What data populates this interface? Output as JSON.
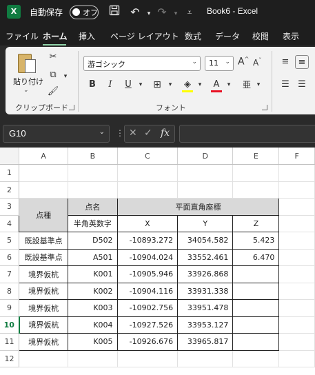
{
  "titlebar": {
    "app_icon": "X",
    "autosave_label": "自動保存",
    "autosave_state": "オフ",
    "doc_title": "Book6  -  Excel"
  },
  "menu": {
    "tabs": [
      "ファイル",
      "ホーム",
      "挿入",
      "ページ レイアウト",
      "数式",
      "データ",
      "校閲",
      "表示"
    ],
    "active": "ホーム"
  },
  "ribbon": {
    "clipboard": {
      "paste_label": "貼り付け",
      "group_label": "クリップボード"
    },
    "font": {
      "font_name": "游ゴシック",
      "font_size": "11",
      "grow_label": "A",
      "shrink_label": "A",
      "bold": "B",
      "italic": "I",
      "underline": "U",
      "group_label": "フォント",
      "fill_color": "#ffff00",
      "font_color": "#e81123"
    }
  },
  "formula_bar": {
    "name_box": "G10",
    "formula_value": ""
  },
  "sheet": {
    "columns": [
      "A",
      "B",
      "C",
      "D",
      "E",
      "F"
    ],
    "rows": [
      "1",
      "2",
      "3",
      "4",
      "5",
      "6",
      "7",
      "8",
      "9",
      "10",
      "11",
      "12"
    ],
    "selected_row": "10",
    "header": {
      "point_type": "点種",
      "point_name": "点名",
      "coord_title": "平面直角座標",
      "name_note": "半角英数字",
      "x": "X",
      "y": "Y",
      "z": "Z"
    },
    "data": [
      {
        "type": "既設基準点",
        "name": "D502",
        "x": "-10893.272",
        "y": "34054.582",
        "z": "5.423"
      },
      {
        "type": "既設基準点",
        "name": "A501",
        "x": "-10904.024",
        "y": "33552.461",
        "z": "6.470"
      },
      {
        "type": "境界仮杭",
        "name": "K001",
        "x": "-10905.946",
        "y": "33926.868",
        "z": ""
      },
      {
        "type": "境界仮杭",
        "name": "K002",
        "x": "-10904.116",
        "y": "33931.338",
        "z": ""
      },
      {
        "type": "境界仮杭",
        "name": "K003",
        "x": "-10902.756",
        "y": "33951.478",
        "z": ""
      },
      {
        "type": "境界仮杭",
        "name": "K004",
        "x": "-10927.526",
        "y": "33953.127",
        "z": ""
      },
      {
        "type": "境界仮杭",
        "name": "K005",
        "x": "-10926.676",
        "y": "33965.817",
        "z": ""
      }
    ]
  }
}
